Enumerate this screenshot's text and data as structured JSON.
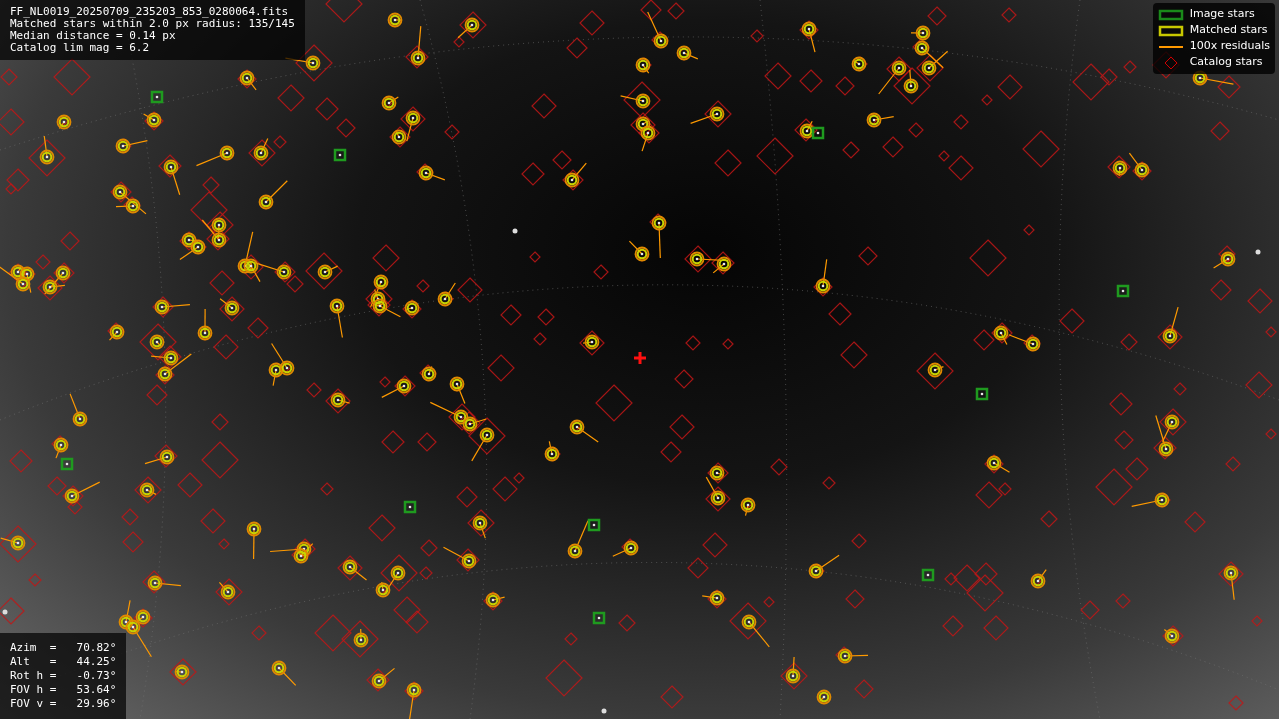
{
  "info_lines": [
    "FF_NL0019_20250709_235203_853_0280064.fits",
    "Matched stars within 2.0 px radius: 135/145",
    "Median distance = 0.14 px",
    "Catalog lim mag = 6.2"
  ],
  "legend": [
    {
      "kind": "box",
      "label": "Image stars",
      "color": "#1a8a1a"
    },
    {
      "kind": "box",
      "label": "Matched stars",
      "color": "#c8c800"
    },
    {
      "kind": "line",
      "label": "100x residuals",
      "color": "#ff9900"
    },
    {
      "kind": "diamond",
      "label": "Catalog stars",
      "color": "#cc0000"
    }
  ],
  "pointing": [
    {
      "label": "Azim  =",
      "value": "70.82°"
    },
    {
      "label": "Alt   =",
      "value": "44.25°"
    },
    {
      "label": "Rot h =",
      "value": "-0.73°"
    },
    {
      "label": "FOV h =",
      "value": "53.64°"
    },
    {
      "label": "FOV v =",
      "value": "29.96°"
    }
  ]
}
